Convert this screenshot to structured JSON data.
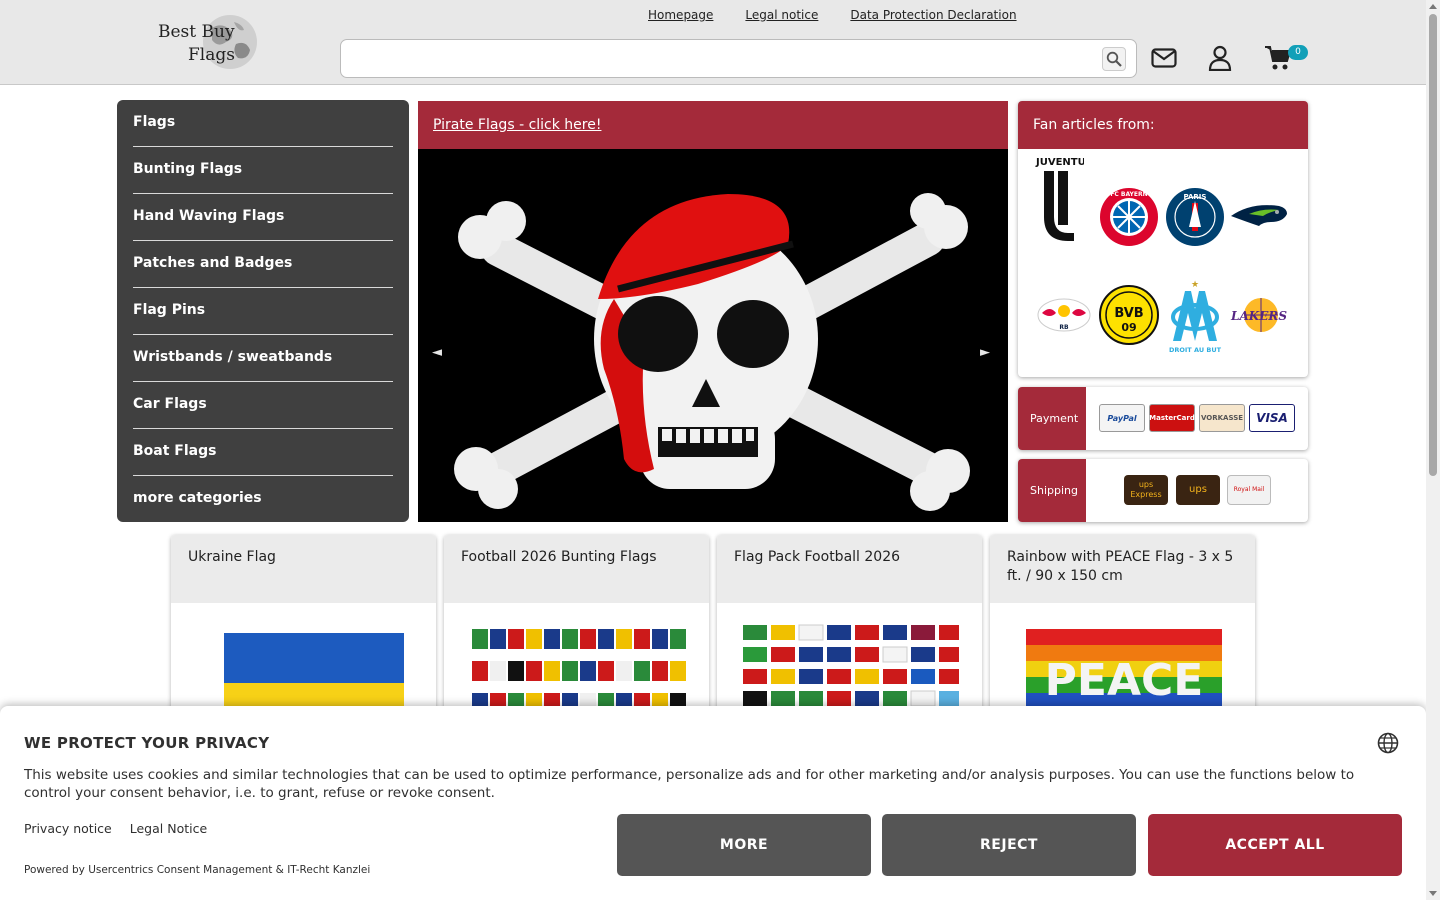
{
  "header": {
    "logo": {
      "line1": "Best Buy",
      "line2": "Flags"
    },
    "links": [
      "Homepage",
      "Legal notice",
      "Data Protection Declaration"
    ],
    "search": {
      "value": "",
      "placeholder": ""
    },
    "icons": [
      "search-icon",
      "mail-icon",
      "user-icon",
      "cart-icon"
    ],
    "cart_count": "0"
  },
  "sidenav": {
    "items": [
      "Flags",
      "Bunting Flags",
      "Hand Waving Flags",
      "Patches and Badges",
      "Flag Pins",
      "Wristbands / sweatbands",
      "Car Flags",
      "Boat Flags",
      "more categories"
    ]
  },
  "hero": {
    "title": "Pirate Flags - click here!",
    "prev": "◄",
    "next": "►"
  },
  "fan": {
    "title": "Fan articles from:",
    "teams": [
      {
        "name": "Juventus",
        "text": "JUVENTUS"
      },
      {
        "name": "FC Bayern München",
        "text": "FC BAYERN"
      },
      {
        "name": "Paris Saint-Germain",
        "text": "PARIS"
      },
      {
        "name": "Seattle Seahawks",
        "text": ""
      },
      {
        "name": "RB Leipzig",
        "text": "RB"
      },
      {
        "name": "Borussia Dortmund",
        "text": "BVB"
      },
      {
        "name": "Olympique de Marseille",
        "text": "DROIT AU BUT"
      },
      {
        "name": "Los Angeles Lakers",
        "text": "LAKERS"
      }
    ]
  },
  "payment": {
    "label": "Payment",
    "methods": [
      "PayPal",
      "MasterCard",
      "VORKASSE",
      "VISA"
    ]
  },
  "shipping": {
    "label": "Shipping",
    "methods": [
      {
        "line1": "ups",
        "line2": "Express"
      },
      {
        "line1": "ups",
        "line2": ""
      },
      {
        "line1": "Royal Mail",
        "line2": ""
      }
    ]
  },
  "products": [
    {
      "title": "Ukraine Flag"
    },
    {
      "title": "Football 2026 Bunting Flags"
    },
    {
      "title": "Flag Pack Football 2026"
    },
    {
      "title": "Rainbow with PEACE Flag - 3 x 5 ft. / 90 x 150 cm",
      "image_text": "PEACE"
    }
  ],
  "cookie": {
    "title": "WE PROTECT YOUR PRIVACY",
    "text": "This website uses cookies and similar technologies that can be used to optimize performance, personalize ads and for other marketing and/or analysis purposes. You can use the functions below to control your consent behavior, i.e. to grant, refuse or revoke consent.",
    "links": [
      "Privacy notice",
      "Legal Notice"
    ],
    "powered": "Powered by Usercentrics Consent Management & IT-Recht Kanzlei",
    "buttons": {
      "more": "MORE",
      "reject": "REJECT",
      "accept": "ACCEPT ALL"
    }
  },
  "colors": {
    "brand": "#a42a3a",
    "nav_bg": "#404040",
    "header_bg": "#e8e8e8",
    "button_grey": "#555555",
    "cart_badge": "#12a0b8"
  }
}
